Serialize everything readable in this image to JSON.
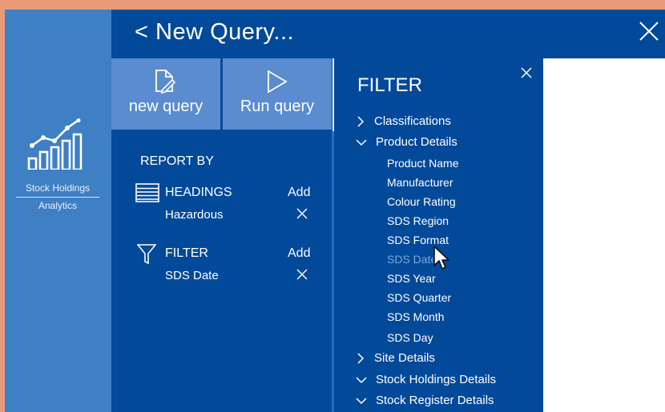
{
  "left_nav": {
    "app_label": "Stock Holdings",
    "app_sublabel": "Analytics",
    "icon": "chart-bars-trend-icon"
  },
  "header": {
    "title": "New Query...",
    "back_icon": "chevron-left-icon",
    "close_icon": "close-icon"
  },
  "toolbar": {
    "new_query_label": "new query",
    "run_query_label": "Run query"
  },
  "report": {
    "report_by_label": "REPORT BY",
    "headings": {
      "title": "HEADINGS",
      "add_label": "Add",
      "value": "Hazardous"
    },
    "filter": {
      "title": "FILTER",
      "add_label": "Add",
      "value": "SDS Date"
    }
  },
  "filter_panel": {
    "title": "FILTER",
    "classifications": "Classifications",
    "product_details": "Product Details",
    "product_items": [
      "Product Name",
      "Manufacturer",
      "Colour Rating",
      "SDS Region",
      "SDS Format",
      "SDS Date",
      "SDS Year",
      "SDS Quarter",
      "SDS Month",
      "SDS Day"
    ],
    "site_details": "Site Details",
    "stock_holdings_details": "Stock Holdings Details",
    "stock_register_details": "Stock Register Details"
  },
  "colors": {
    "panel_blue": "#02499a",
    "nav_blue": "#3f7fc4",
    "button_blue": "#5a8ccf",
    "dim_item": "#7ea6d8"
  }
}
